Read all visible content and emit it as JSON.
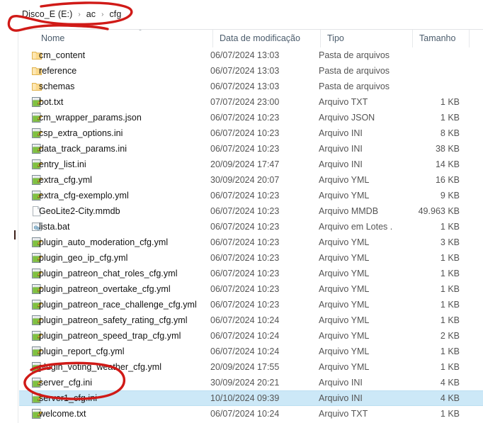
{
  "window": {
    "kind": "file-explorer-list-view",
    "selection_color": "#cce8f7",
    "annotation_color": "#d01a17"
  },
  "breadcrumb": {
    "name": "address-bar",
    "separator": "›",
    "crumbs": [
      "Disco_E (E:)",
      "ac",
      "cfg"
    ]
  },
  "columns": {
    "name": "Nome",
    "date_modified": "Data de modificação",
    "type": "Tipo",
    "size": "Tamanho",
    "sort_caret": "˄",
    "sorted_by": "Nome",
    "sort_direction": "ascending"
  },
  "rows": [
    {
      "name": "cm_content",
      "date": "06/07/2024 13:03",
      "type": "Pasta de arquivos",
      "size": "",
      "icon": "folder-icon",
      "selected": false
    },
    {
      "name": "reference",
      "date": "06/07/2024 13:03",
      "type": "Pasta de arquivos",
      "size": "",
      "icon": "folder-icon",
      "selected": false
    },
    {
      "name": "schemas",
      "date": "06/07/2024 13:03",
      "type": "Pasta de arquivos",
      "size": "",
      "icon": "folder-icon",
      "selected": false
    },
    {
      "name": "bot.txt",
      "date": "07/07/2024 23:00",
      "type": "Arquivo TXT",
      "size": "1 KB",
      "icon": "notepad-file-icon",
      "selected": false
    },
    {
      "name": "cm_wrapper_params.json",
      "date": "06/07/2024 10:23",
      "type": "Arquivo JSON",
      "size": "1 KB",
      "icon": "notepad-file-icon",
      "selected": false
    },
    {
      "name": "csp_extra_options.ini",
      "date": "06/07/2024 10:23",
      "type": "Arquivo INI",
      "size": "8 KB",
      "icon": "notepad-file-icon",
      "selected": false
    },
    {
      "name": "data_track_params.ini",
      "date": "06/07/2024 10:23",
      "type": "Arquivo INI",
      "size": "38 KB",
      "icon": "notepad-file-icon",
      "selected": false
    },
    {
      "name": "entry_list.ini",
      "date": "20/09/2024 17:47",
      "type": "Arquivo INI",
      "size": "14 KB",
      "icon": "notepad-file-icon",
      "selected": false
    },
    {
      "name": "extra_cfg.yml",
      "date": "30/09/2024 20:07",
      "type": "Arquivo YML",
      "size": "16 KB",
      "icon": "notepad-file-icon",
      "selected": false
    },
    {
      "name": "extra_cfg-exemplo.yml",
      "date": "06/07/2024 10:23",
      "type": "Arquivo YML",
      "size": "9 KB",
      "icon": "notepad-file-icon",
      "selected": false
    },
    {
      "name": "GeoLite2-City.mmdb",
      "date": "06/07/2024 10:23",
      "type": "Arquivo MMDB",
      "size": "49.963 KB",
      "icon": "blank-page-icon",
      "selected": false
    },
    {
      "name": "lista.bat",
      "date": "06/07/2024 10:23",
      "type": "Arquivo em Lotes ...",
      "size": "1 KB",
      "icon": "batch-gear-icon",
      "selected": false
    },
    {
      "name": "plugin_auto_moderation_cfg.yml",
      "date": "06/07/2024 10:23",
      "type": "Arquivo YML",
      "size": "3 KB",
      "icon": "notepad-file-icon",
      "selected": false
    },
    {
      "name": "plugin_geo_ip_cfg.yml",
      "date": "06/07/2024 10:23",
      "type": "Arquivo YML",
      "size": "1 KB",
      "icon": "notepad-file-icon",
      "selected": false
    },
    {
      "name": "plugin_patreon_chat_roles_cfg.yml",
      "date": "06/07/2024 10:23",
      "type": "Arquivo YML",
      "size": "1 KB",
      "icon": "notepad-file-icon",
      "selected": false
    },
    {
      "name": "plugin_patreon_overtake_cfg.yml",
      "date": "06/07/2024 10:23",
      "type": "Arquivo YML",
      "size": "1 KB",
      "icon": "notepad-file-icon",
      "selected": false
    },
    {
      "name": "plugin_patreon_race_challenge_cfg.yml",
      "date": "06/07/2024 10:23",
      "type": "Arquivo YML",
      "size": "1 KB",
      "icon": "notepad-file-icon",
      "selected": false
    },
    {
      "name": "plugin_patreon_safety_rating_cfg.yml",
      "date": "06/07/2024 10:24",
      "type": "Arquivo YML",
      "size": "1 KB",
      "icon": "notepad-file-icon",
      "selected": false
    },
    {
      "name": "plugin_patreon_speed_trap_cfg.yml",
      "date": "06/07/2024 10:24",
      "type": "Arquivo YML",
      "size": "2 KB",
      "icon": "notepad-file-icon",
      "selected": false
    },
    {
      "name": "plugin_report_cfg.yml",
      "date": "06/07/2024 10:24",
      "type": "Arquivo YML",
      "size": "1 KB",
      "icon": "notepad-file-icon",
      "selected": false
    },
    {
      "name": "plugin_voting_weather_cfg.yml",
      "date": "20/09/2024 17:55",
      "type": "Arquivo YML",
      "size": "1 KB",
      "icon": "notepad-file-icon",
      "selected": false
    },
    {
      "name": "server_cfg.ini",
      "date": "30/09/2024 20:21",
      "type": "Arquivo INI",
      "size": "4 KB",
      "icon": "notepad-file-icon",
      "selected": false
    },
    {
      "name": "server1_cfg.ini",
      "date": "10/10/2024 09:39",
      "type": "Arquivo INI",
      "size": "4 KB",
      "icon": "notepad-file-icon",
      "selected": true
    },
    {
      "name": "welcome.txt",
      "date": "06/07/2024 10:24",
      "type": "Arquivo TXT",
      "size": "1 KB",
      "icon": "notepad-file-icon",
      "selected": false
    }
  ],
  "annotations": [
    {
      "name": "breadcrumb-circle",
      "shape": "hand-drawn-ellipse",
      "target": "Disco_E (E:) > ac > cfg"
    },
    {
      "name": "server-files-circle",
      "shape": "hand-drawn-ellipse",
      "target": "server_cfg.ini / server1_cfg.ini"
    }
  ]
}
